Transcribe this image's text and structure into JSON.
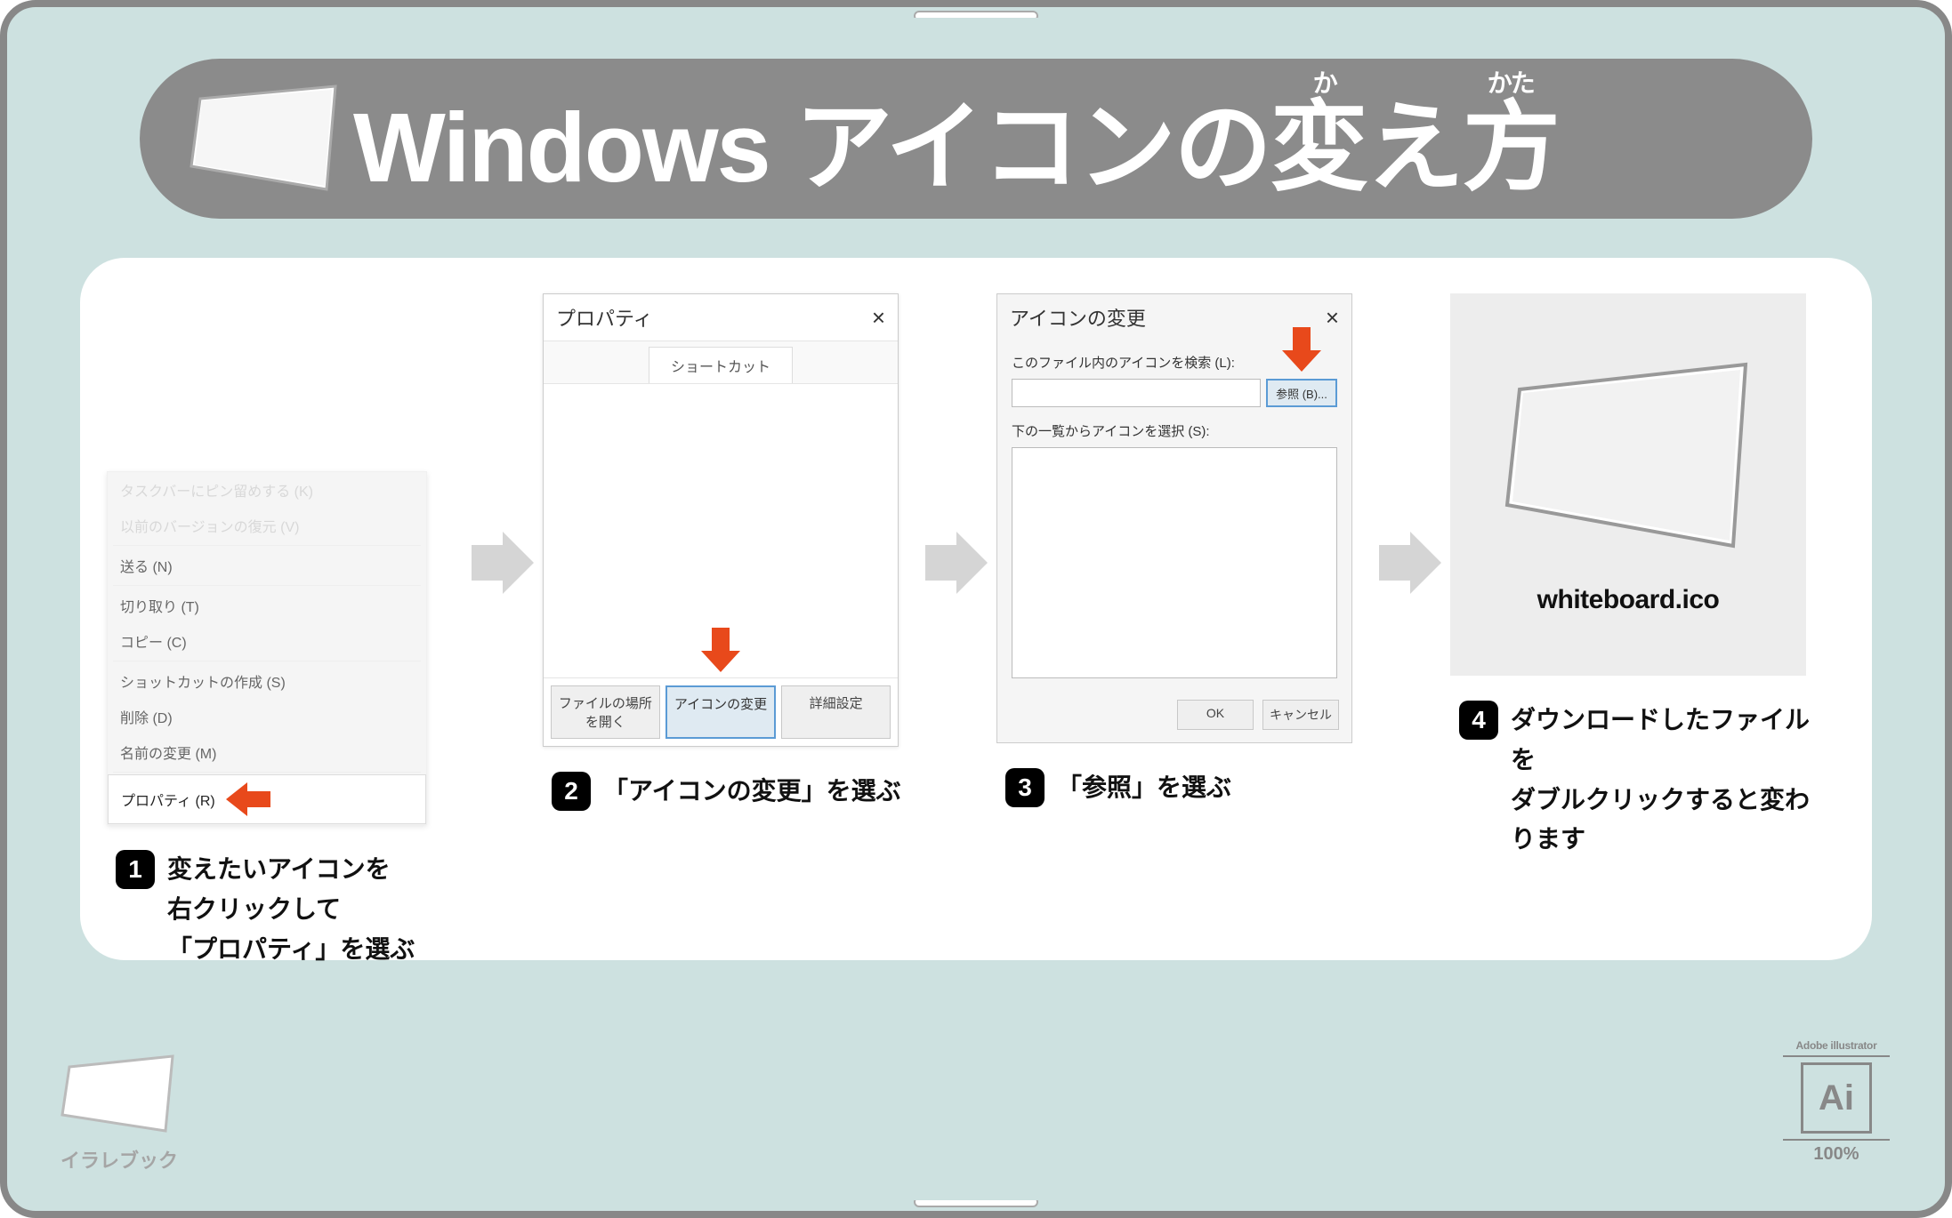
{
  "title": {
    "text": "Windows アイコンの変え方",
    "ruby1": "か",
    "ruby2": "かた"
  },
  "steps": {
    "s1": {
      "num": "1",
      "caption_l1": "変えたいアイコンを",
      "caption_l2": "右クリックして",
      "caption_l3": "「プロパティ」を選ぶ"
    },
    "s2": {
      "num": "2",
      "caption": "「アイコンの変更」を選ぶ"
    },
    "s3": {
      "num": "3",
      "caption": "「参照」を選ぶ"
    },
    "s4": {
      "num": "4",
      "caption_l1": "ダウンロードしたファイルを",
      "caption_l2": "ダブルクリックすると変わります"
    }
  },
  "context_menu": {
    "items": {
      "i1": "タスクバーにピン留めする (K)",
      "i2": "以前のバージョンの復元 (V)",
      "i3": "送る (N)",
      "i4": "切り取り (T)",
      "i5": "コピー (C)",
      "i6": "ショットカットの作成 (S)",
      "i7": "削除 (D)",
      "i8": "名前の変更 (M)",
      "i9": "プロパティ (R)"
    }
  },
  "dialog2": {
    "title": "プロパティ",
    "close": "×",
    "tab": "ショートカット",
    "btn_open": "ファイルの場所を開く",
    "btn_change": "アイコンの変更",
    "btn_detail": "詳細設定"
  },
  "dialog3": {
    "title": "アイコンの変更",
    "close": "×",
    "label_search": "このファイル内のアイコンを検索 (L):",
    "browse": "参照 (B)...",
    "label_list": "下の一覧からアイコンを選択 (S):",
    "ok": "OK",
    "cancel": "キャンセル"
  },
  "step4": {
    "filename": "whiteboard.ico"
  },
  "footer": {
    "brand": "イラレブック",
    "ai_top": "Adobe illustrator",
    "ai_mark": "Ai",
    "ai_pct": "100%"
  }
}
